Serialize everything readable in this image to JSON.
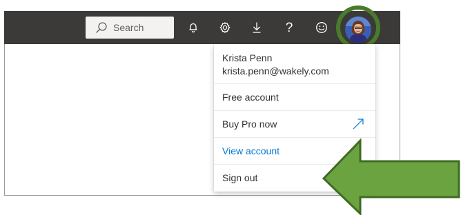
{
  "header": {
    "search": {
      "placeholder": "Search",
      "icon": "search-icon"
    },
    "icons": [
      "bell-icon",
      "gear-icon",
      "download-icon",
      "help-icon",
      "smiley-icon"
    ],
    "help_glyph": "?",
    "avatar_ring_color": "#4a7a2c"
  },
  "account_menu": {
    "user_name": "Krista Penn",
    "user_email": "krista.penn@wakely.com",
    "items": [
      {
        "label": "Free account"
      },
      {
        "label": "Buy Pro now",
        "icon": "external-arrow-icon"
      },
      {
        "label": "View account"
      },
      {
        "label": "Sign out"
      }
    ]
  },
  "annotation": {
    "arrow_color": "#6aa33f",
    "arrow_border_color": "#3f6b22"
  },
  "colors": {
    "topbar": "#3b3a39",
    "link": "#0078d4",
    "text": "#323130"
  }
}
